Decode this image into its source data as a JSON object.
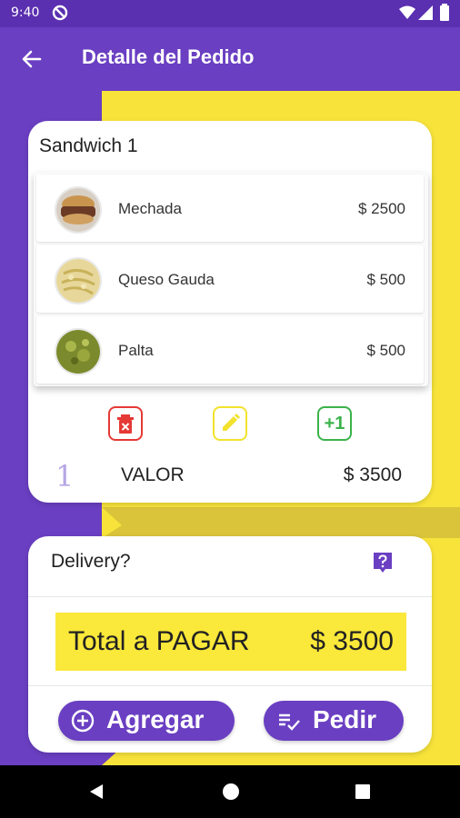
{
  "status_bar": {
    "time": "9:40",
    "icons": [
      "do-not-disturb-icon",
      "wifi-icon",
      "signal-icon",
      "battery-icon"
    ]
  },
  "app_bar": {
    "title": "Detalle del Pedido",
    "back_icon": "arrow-left-icon"
  },
  "colors": {
    "primary": "#6a3fc2",
    "accent_yellow": "#fae83a",
    "delete": "#e53935",
    "edit": "#f2e22c",
    "add": "#3bb34a",
    "background_yellow": "#f7e33a"
  },
  "order_card": {
    "title": "Sandwich 1",
    "items": [
      {
        "name": "Mechada",
        "price": "$ 2500"
      },
      {
        "name": "Queso Gauda",
        "price": "$ 500"
      },
      {
        "name": "Palta",
        "price": "$ 500"
      }
    ],
    "actions": {
      "delete_icon": "delete-icon",
      "edit_icon": "pencil-icon",
      "add_one_label": "+1"
    },
    "quantity": "1",
    "valor_label": "VALOR",
    "valor_value": "$ 3500"
  },
  "summary_card": {
    "delivery_label": "Delivery?",
    "help_icon": "help-icon",
    "total_label": "Total a PAGAR",
    "total_value": "$ 3500",
    "add_button": "Agregar",
    "order_button": "Pedir"
  }
}
